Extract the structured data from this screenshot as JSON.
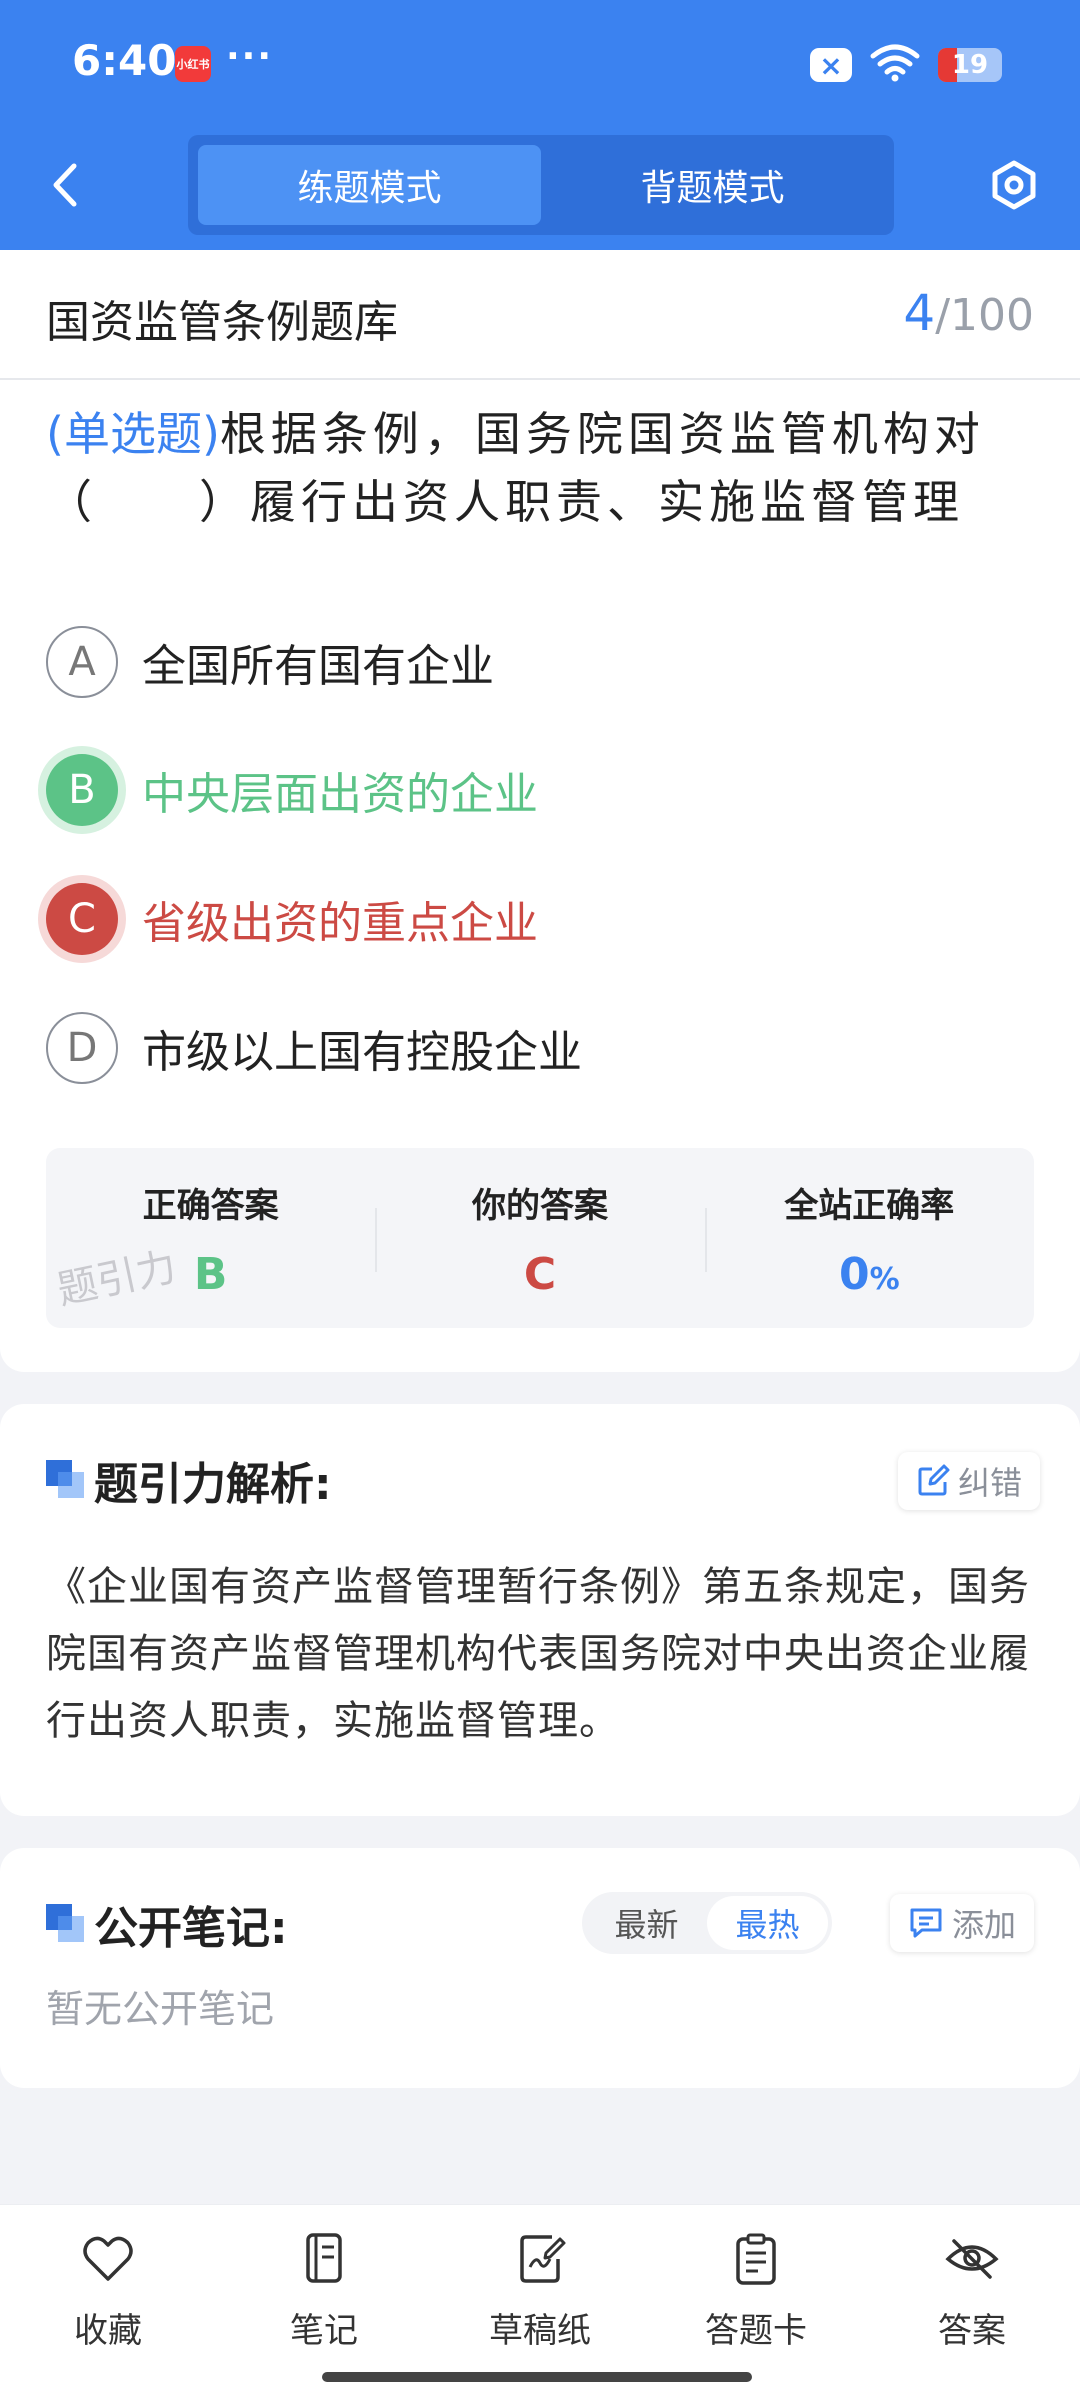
{
  "status_bar": {
    "time": "6:40",
    "app_badge": "小红书",
    "more": "···",
    "battery": "19",
    "x_icon": "×"
  },
  "nav": {
    "modes": [
      "练题模式",
      "背题模式"
    ],
    "active_mode": 0
  },
  "bank": {
    "title": "国资监管条例题库",
    "current": "4",
    "total": "/100"
  },
  "question": {
    "type": "(单选题)",
    "text": "根据条例，国务院国资监管机构对（　　）履行出资人职责、实施监督管理"
  },
  "options": [
    {
      "letter": "A",
      "text": "全国所有国有企业",
      "state": "normal"
    },
    {
      "letter": "B",
      "text": "中央层面出资的企业",
      "state": "correct"
    },
    {
      "letter": "C",
      "text": "省级出资的重点企业",
      "state": "wrong"
    },
    {
      "letter": "D",
      "text": "市级以上国有控股企业",
      "state": "normal"
    }
  ],
  "answer_summary": {
    "correct_label": "正确答案",
    "correct_value": "B",
    "yours_label": "你的答案",
    "yours_value": "C",
    "rate_label": "全站正确率",
    "rate_value": "0",
    "rate_unit": "%",
    "watermark": "题引力"
  },
  "explanation": {
    "title": "题引力解析:",
    "report_button": "纠错",
    "text": "《企业国有资产监督管理暂行条例》第五条规定，国务院国有资产监督管理机构代表国务院对中央出资企业履行出资人职责，实施监督管理。"
  },
  "notes": {
    "title": "公开笔记:",
    "sort_options": [
      "最新",
      "最热"
    ],
    "active_sort": 1,
    "add_button": "添加",
    "empty_text": "暂无公开笔记"
  },
  "toolbar": [
    {
      "label": "收藏",
      "icon": "heart-icon"
    },
    {
      "label": "笔记",
      "icon": "notebook-icon"
    },
    {
      "label": "草稿纸",
      "icon": "draft-paper-icon"
    },
    {
      "label": "答题卡",
      "icon": "answer-card-icon"
    },
    {
      "label": "答案",
      "icon": "eye-off-icon"
    }
  ],
  "colors": {
    "primary": "#3b82f0",
    "correct": "#5cc387",
    "wrong": "#cc4a44"
  }
}
